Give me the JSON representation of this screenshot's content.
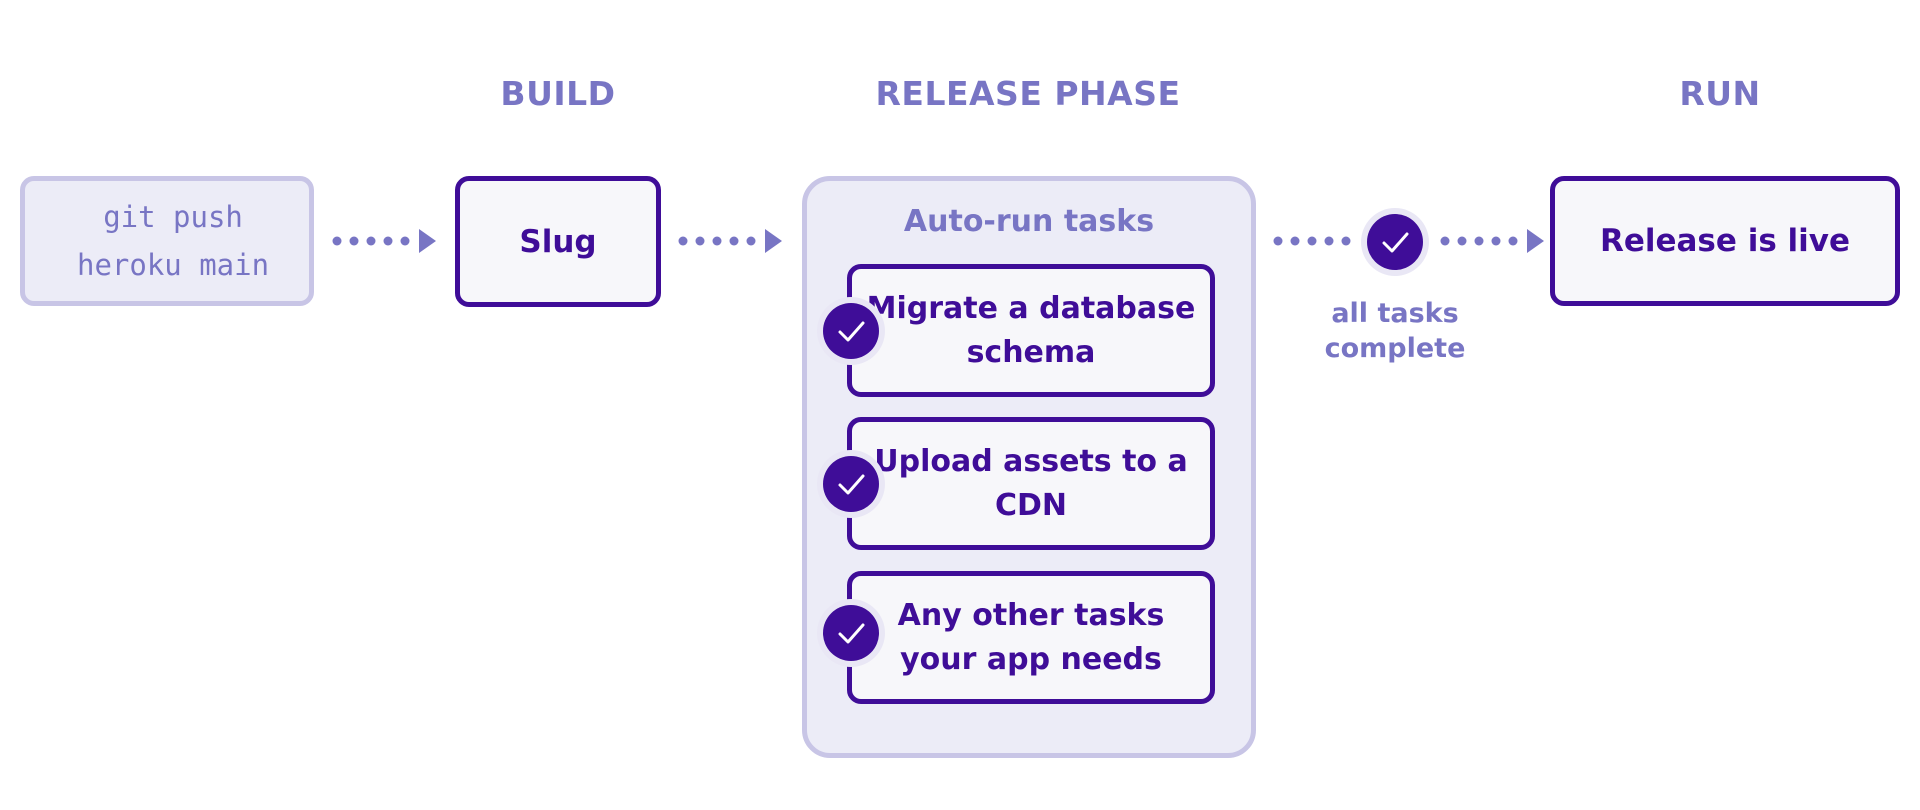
{
  "phases": {
    "build": "BUILD",
    "release": "RELEASE PHASE",
    "run": "RUN"
  },
  "git_command": {
    "line1": "git push",
    "line2": "heroku main"
  },
  "slug_label": "Slug",
  "release_container": {
    "title": "Auto-run tasks",
    "tasks": [
      {
        "label": "Migrate a database schema",
        "status": "complete"
      },
      {
        "label": "Upload assets to a CDN",
        "status": "complete"
      },
      {
        "label": "Any other tasks your app needs",
        "status": "complete"
      }
    ]
  },
  "completion": {
    "caption_line1": "all tasks",
    "caption_line2": "complete",
    "status": "complete"
  },
  "release_live_label": "Release is live",
  "colors": {
    "primary": "#3f0d98",
    "accent": "#7875c4",
    "muted_border": "#c8c5e6",
    "muted_fill": "#ececf7",
    "box_fill": "#f7f7fa"
  }
}
